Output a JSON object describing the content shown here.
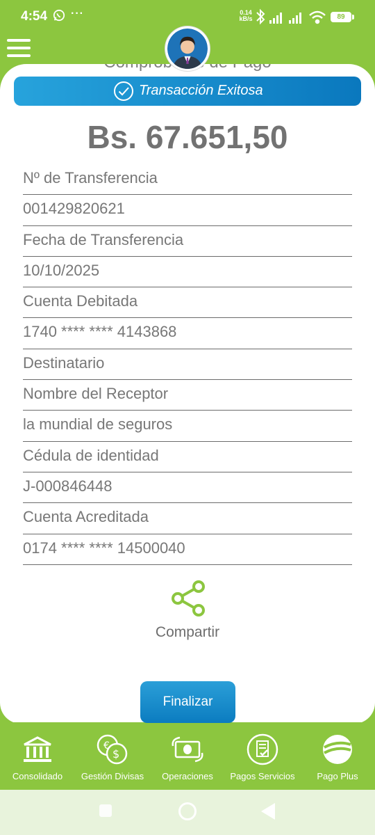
{
  "status_bar": {
    "time": "4:54",
    "notification_dots": "···",
    "net_speed_value": "0.14",
    "net_speed_unit": "kB/s",
    "battery": "89"
  },
  "header": {
    "title": "Comprobante de Pago"
  },
  "banner": {
    "text": "Transacción Exitosa",
    "color_start": "#27a3dc",
    "color_end": "#0a78be"
  },
  "amount": "Bs. 67.651,50",
  "details": [
    "Nº de Transferencia",
    "001429820621",
    "Fecha de Transferencia",
    "10/10/2025",
    "Cuenta Debitada",
    "1740 **** **** 4143868",
    "Destinatario",
    "Nombre del Receptor",
    "la mundial de seguros",
    "Cédula de identidad",
    "J-000846448",
    "Cuenta Acreditada",
    "0174 **** **** 14500040"
  ],
  "share": {
    "label": "Compartir",
    "icon": "share-icon"
  },
  "actions": {
    "finalize_label": "Finalizar"
  },
  "bottom_nav": [
    {
      "label": "Consolidado",
      "icon": "bank-icon"
    },
    {
      "label": "Gestión Divisas",
      "icon": "currency-exchange-icon"
    },
    {
      "label": "Operaciones",
      "icon": "money-transfer-icon"
    },
    {
      "label": "Pagos Servicios",
      "icon": "bill-payment-icon"
    },
    {
      "label": "Pago Plus",
      "icon": "pago-plus-icon"
    }
  ],
  "colors": {
    "brand_green": "#8cc63f",
    "brand_blue": "#0b7cc0",
    "text_gray": "#777777"
  }
}
